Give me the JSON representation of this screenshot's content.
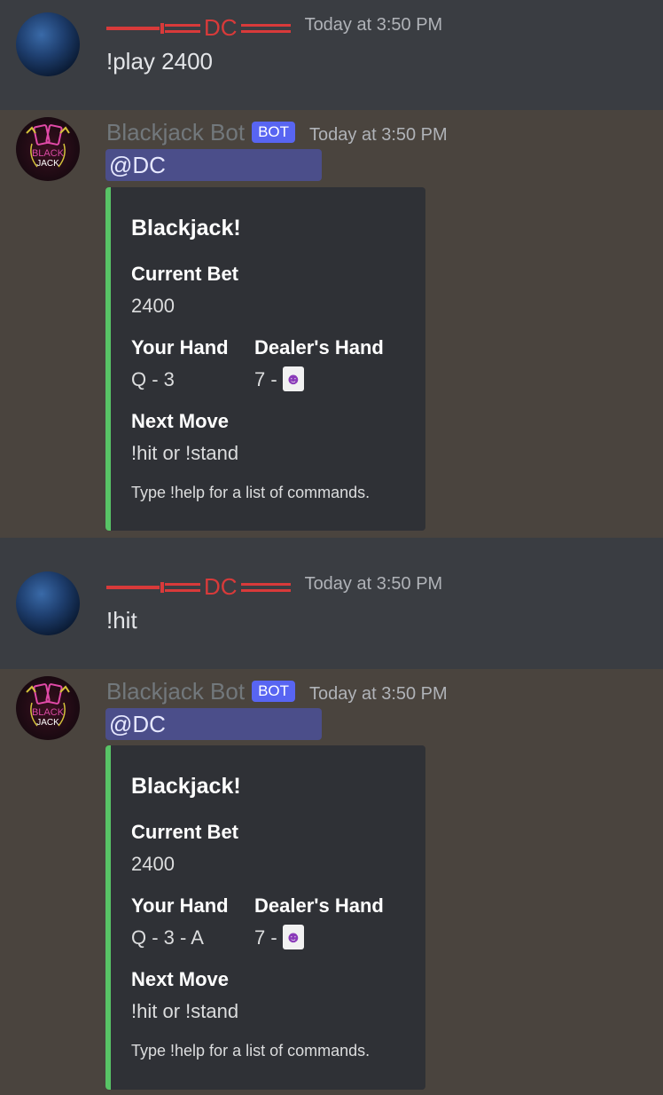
{
  "messages": [
    {
      "author": "DC",
      "timestamp": "Today at 3:50 PM",
      "text": "!play 2400"
    },
    {
      "author": "Blackjack Bot",
      "bot_tag": "BOT",
      "timestamp": "Today at 3:50 PM",
      "mention": "@DC",
      "embed": {
        "title": "Blackjack!",
        "current_bet_label": "Current Bet",
        "current_bet_value": "2400",
        "your_hand_label": "Your Hand",
        "your_hand_value": "Q - 3",
        "dealer_hand_label": "Dealer's Hand",
        "dealer_hand_value": "7 -",
        "next_move_label": "Next Move",
        "next_move_value": "!hit or !stand",
        "footer": "Type !help for a list of commands."
      }
    },
    {
      "author": "DC",
      "timestamp": "Today at 3:50 PM",
      "text": "!hit"
    },
    {
      "author": "Blackjack Bot",
      "bot_tag": "BOT",
      "timestamp": "Today at 3:50 PM",
      "mention": "@DC",
      "embed": {
        "title": "Blackjack!",
        "current_bet_label": "Current Bet",
        "current_bet_value": "2400",
        "your_hand_label": "Your Hand",
        "your_hand_value": "Q - 3 - A",
        "dealer_hand_label": "Dealer's Hand",
        "dealer_hand_value": "7 -",
        "next_move_label": "Next Move",
        "next_move_value": "!hit or !stand",
        "footer": "Type !help for a list of commands."
      }
    }
  ],
  "colors": {
    "user_row_bg": "#3a3d42",
    "bot_row_bg": "#4a443e",
    "username_red": "#d83a3a",
    "bot_tag_bg": "#5865f2",
    "embed_accent": "#58c466",
    "embed_bg": "#2f3136"
  },
  "icons": [
    "user-avatar",
    "bot-avatar",
    "joker-card-icon"
  ]
}
